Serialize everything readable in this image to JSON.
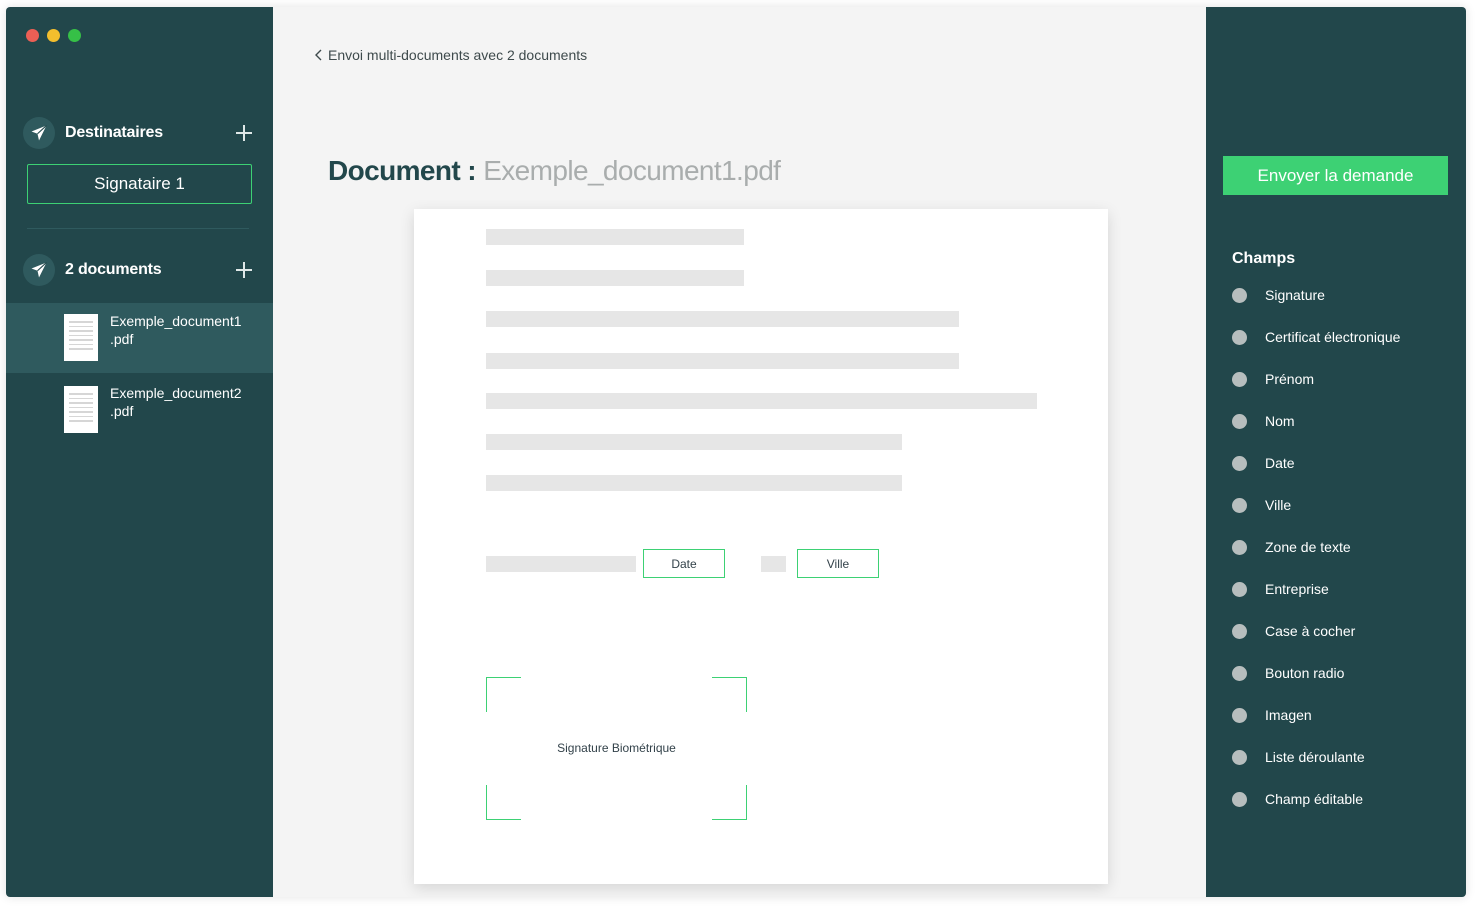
{
  "window": {
    "controls": [
      "close",
      "minimize",
      "zoom"
    ]
  },
  "sidebar": {
    "recipients": {
      "title": "Destinataires",
      "signer_button": "Signataire 1"
    },
    "documents": {
      "title": "2 documents",
      "items": [
        {
          "name": "Exemple_document1\n.pdf",
          "active": true
        },
        {
          "name": "Exemple_document2\n.pdf",
          "active": false
        }
      ]
    }
  },
  "main": {
    "back_link": "Envoi multi-documents avec 2 documents",
    "doc_title_label": "Document :",
    "doc_title_filename": "Exemple_document1.pdf",
    "fields": {
      "date": "Date",
      "city": "Ville",
      "signature": "Signature Biométrique"
    }
  },
  "right_panel": {
    "send_button": "Envoyer la demande",
    "fields_title": "Champs",
    "fields": [
      "Signature",
      "Certificat électronique",
      "Prénom",
      "Nom",
      "Date",
      "Ville",
      "Zone de texte",
      "Entreprise",
      "Case à cocher",
      "Bouton radio",
      "Imagen",
      "Liste déroulante",
      "Champ éditable"
    ]
  },
  "colors": {
    "sidebar_bg": "#22474b",
    "accent_green": "#3dd174",
    "active_item": "#2f5a5e",
    "canvas_bg": "#f4f4f4"
  }
}
